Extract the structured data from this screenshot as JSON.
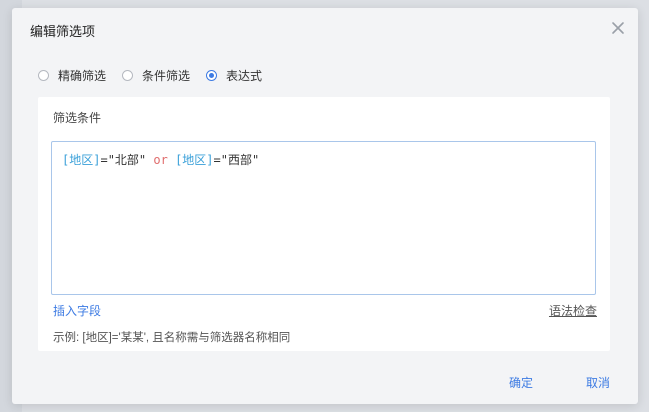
{
  "dialog": {
    "title": "编辑筛选项",
    "close_icon": "close-icon"
  },
  "modes": [
    {
      "label": "精确筛选",
      "selected": false
    },
    {
      "label": "条件筛选",
      "selected": false
    },
    {
      "label": "表达式",
      "selected": true
    }
  ],
  "panel": {
    "label": "筛选条件",
    "expression": {
      "tokens": [
        {
          "text": "[地区]",
          "type": "field"
        },
        {
          "text": "=",
          "type": "op"
        },
        {
          "text": "\"北部\"",
          "type": "str"
        },
        {
          "text": " ",
          "type": "op"
        },
        {
          "text": "or",
          "type": "kw"
        },
        {
          "text": " ",
          "type": "op"
        },
        {
          "text": "[地区]",
          "type": "field"
        },
        {
          "text": "=",
          "type": "op"
        },
        {
          "text": "\"西部\"",
          "type": "str"
        }
      ]
    },
    "insert_field_label": "插入字段",
    "syntax_check_label": "语法检查",
    "example": "示例: [地区]='某某', 且名称需与筛选器名称相同"
  },
  "footer": {
    "confirm_label": "确定",
    "cancel_label": "取消"
  },
  "colors": {
    "accent": "#3d7be3",
    "field_token": "#3aa0d9",
    "keyword_token": "#e06c6c"
  }
}
